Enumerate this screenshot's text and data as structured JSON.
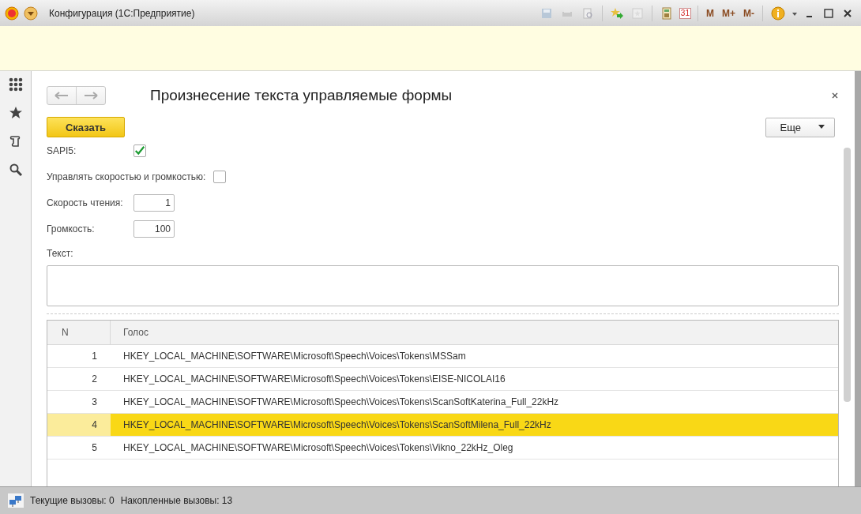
{
  "window": {
    "title": "Конфигурация  (1С:Предприятие)"
  },
  "toolbar": {
    "calendar_day": "31",
    "memory_buttons": [
      "M",
      "M+",
      "M-"
    ]
  },
  "form": {
    "title": "Произнесение текста управляемые формы",
    "say_button": "Сказать",
    "more_button": "Еще",
    "fields": [
      {
        "kind": "checkbox",
        "label": "SAPI5:",
        "checked": true
      },
      {
        "kind": "checkbox",
        "label": "Управлять скоростью и громкостью:",
        "checked": false
      },
      {
        "kind": "number",
        "label": "Скорость чтения:",
        "value": "1"
      },
      {
        "kind": "number",
        "label": "Громкость:",
        "value": "100"
      }
    ],
    "text_label": "Текст:",
    "table": {
      "columns": [
        "N",
        "Голос"
      ],
      "rows": [
        {
          "n": "1",
          "voice": "HKEY_LOCAL_MACHINE\\SOFTWARE\\Microsoft\\Speech\\Voices\\Tokens\\MSSam",
          "selected": false
        },
        {
          "n": "2",
          "voice": "HKEY_LOCAL_MACHINE\\SOFTWARE\\Microsoft\\Speech\\Voices\\Tokens\\EISE-NICOLAI16",
          "selected": false
        },
        {
          "n": "3",
          "voice": "HKEY_LOCAL_MACHINE\\SOFTWARE\\Microsoft\\Speech\\Voices\\Tokens\\ScanSoftKaterina_Full_22kHz",
          "selected": false
        },
        {
          "n": "4",
          "voice": "HKEY_LOCAL_MACHINE\\SOFTWARE\\Microsoft\\Speech\\Voices\\Tokens\\ScanSoftMilena_Full_22kHz",
          "selected": true
        },
        {
          "n": "5",
          "voice": "HKEY_LOCAL_MACHINE\\SOFTWARE\\Microsoft\\Speech\\Voices\\Tokens\\Vikno_22kHz_Oleg",
          "selected": false
        }
      ]
    }
  },
  "status_bar": {
    "current_calls": "Текущие вызовы: 0",
    "accumulated_calls": "Накопленные вызовы: 13"
  }
}
